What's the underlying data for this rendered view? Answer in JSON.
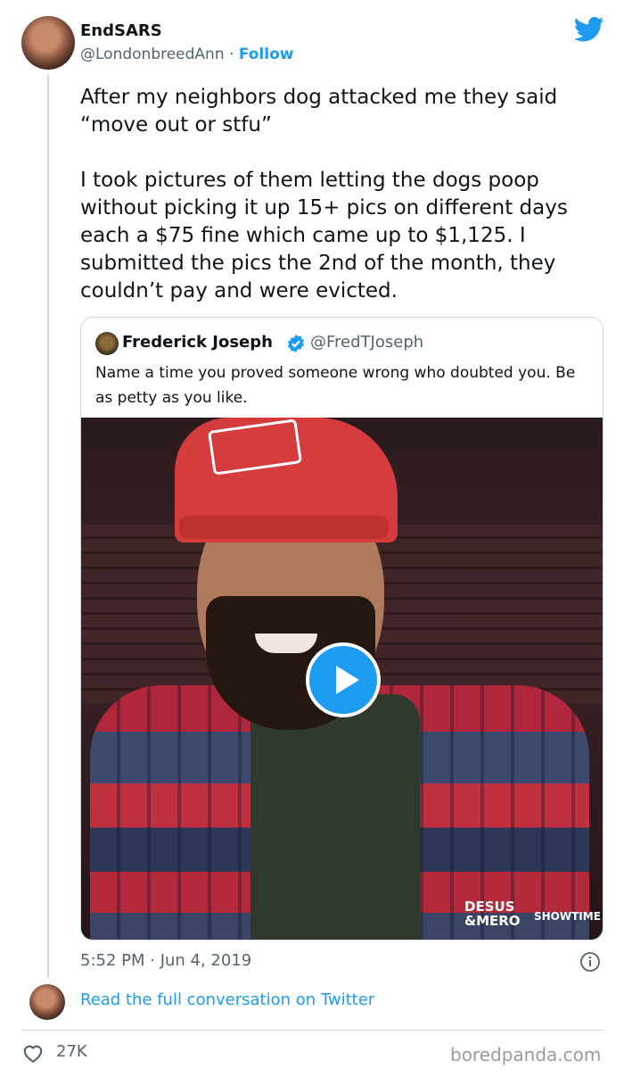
{
  "tweet": {
    "display_name": "EndSARS",
    "handle": "@LondonbreedAnn",
    "separator": " · ",
    "follow_label": "Follow",
    "text": "After my neighbors dog attacked me they said “move out or stfu”\n\nI took pictures of them letting the dogs poop without picking it up 15+ pics on different days each a $75 fine which came up to $1,125. I submitted the pics the 2nd of the month, they couldn’t pay and were evicted.",
    "timestamp": "5:52 PM · Jun 4, 2019",
    "read_more": "Read the full conversation on Twitter",
    "like_count": "27K"
  },
  "quoted_tweet": {
    "display_name": "Frederick Joseph",
    "handle": "@FredTJoseph",
    "text": "Name a time you proved someone wrong who doubted you. Be as petty as you like.",
    "media": {
      "watermark_line1": "DESUS",
      "watermark_line2": "&MERO",
      "watermark_network": "SHOWTIME"
    }
  },
  "source": "boredpanda.com",
  "colors": {
    "accent": "#1d9bf0",
    "secondary_text": "#536471",
    "border": "#cfd9de"
  },
  "icons": [
    "twitter-bird-icon",
    "verified-badge-icon",
    "play-icon",
    "info-icon",
    "heart-icon"
  ]
}
